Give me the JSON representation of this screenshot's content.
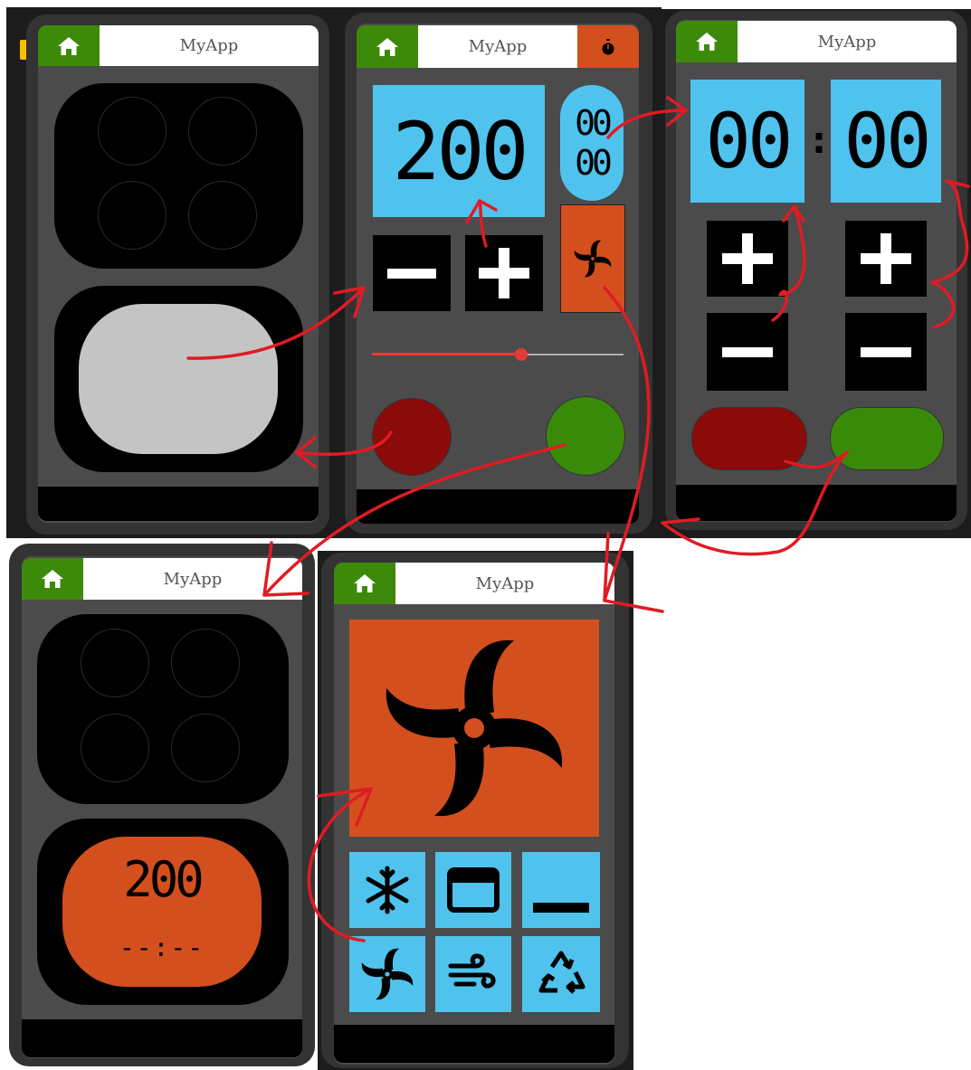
{
  "app": {
    "title": "MyApp"
  },
  "screen2": {
    "temperature": "200",
    "timer_hours": "00",
    "timer_minutes": "00",
    "minus_label": "−",
    "plus_label": "+",
    "slider_value_percent": 60
  },
  "screen3": {
    "hours": "00",
    "minutes": "00",
    "separator": ":",
    "plus_label": "+",
    "minus_label": "−"
  },
  "screen4": {
    "oven_temperature": "200",
    "oven_time": "--:--"
  },
  "screen5": {
    "modes": [
      "snowflake-icon",
      "grill-icon",
      "bottom-heat-icon",
      "fan-icon",
      "wind-icon",
      "recycle-icon"
    ]
  },
  "colors": {
    "home_green": "#3d8a0b",
    "accent_orange": "#d44f1e",
    "display_blue": "#4fc3ee",
    "cancel_red": "#8b0a0a",
    "confirm_green": "#3a8a0a",
    "annotation_red": "#e01b24"
  }
}
